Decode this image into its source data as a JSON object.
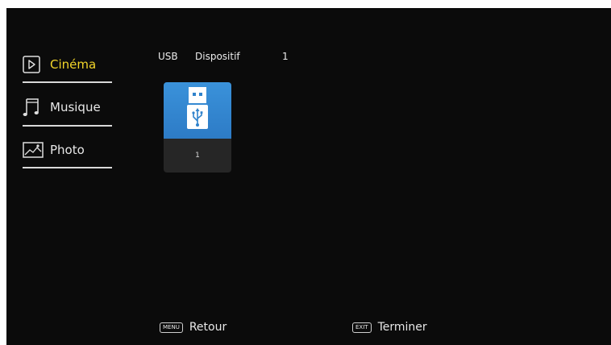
{
  "menu": {
    "items": [
      {
        "label": "Cinéma",
        "icon": "play-icon",
        "active": true
      },
      {
        "label": "Musique",
        "icon": "music-note-icon",
        "active": false
      },
      {
        "label": "Photo",
        "icon": "photo-icon",
        "active": false
      }
    ]
  },
  "header": {
    "source": "USB",
    "device_label": "Dispositif",
    "device_number": "1"
  },
  "tiles": [
    {
      "label": "1",
      "icon": "usb-drive-icon"
    }
  ],
  "footer": {
    "back_key": "MENU",
    "back_label": "Retour",
    "exit_key": "EXIT",
    "exit_label": "Terminer"
  },
  "colors": {
    "background": "#0b0b0b",
    "active_text": "#f2d52a",
    "tile_blue": "#2f82cc",
    "tile_base": "#262626"
  }
}
